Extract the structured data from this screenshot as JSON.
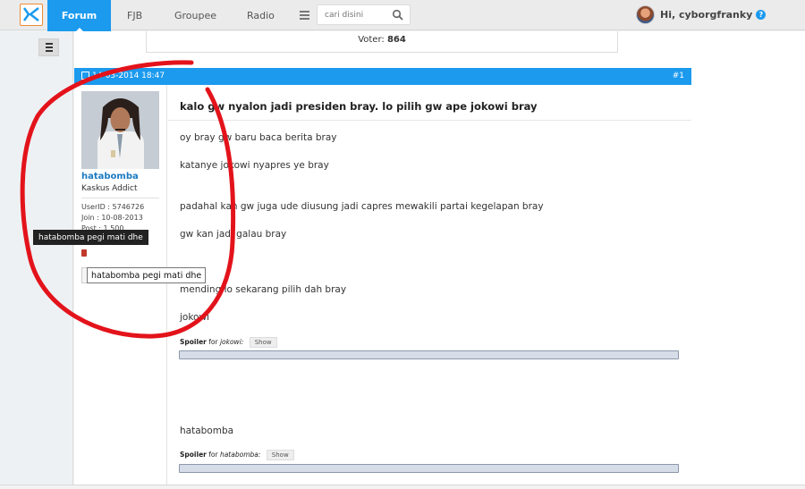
{
  "nav": {
    "items": [
      "Forum",
      "FJB",
      "Groupee",
      "Radio"
    ],
    "search_placeholder": "cari disini",
    "greeting": "Hi, cyborgfranky",
    "help_glyph": "?"
  },
  "poll": {
    "label": "Voter:",
    "value": "864"
  },
  "post": {
    "date": "14-03-2014 18:47",
    "number": "#1",
    "title": "kalo gw nyalon jadi presiden bray. lo pilih gw ape jokowi bray",
    "lines": [
      "oy bray gw baru baca berita bray",
      "katanye jokowi nyapres ye bray",
      "padahal kan gw juga ude diusung jadi capres mewakili partai kegelapan bray",
      "gw kan jadi galau bray",
      "mending lo sekarang pilih dah bray",
      "jokowi",
      "hatabomba"
    ],
    "spoilers": [
      {
        "label": "Spoiler",
        "for_text": "for",
        "target": "jokowi:",
        "button": "Show"
      },
      {
        "label": "Spoiler",
        "for_text": "for",
        "target": "hatabomba:",
        "button": "Show"
      }
    ]
  },
  "author": {
    "username": "hatabomba",
    "rank": "Kaskus Addict",
    "userid": "UserID : 5746726",
    "join": "Join     : 10-08-2013",
    "posts": "Post      : 1.500",
    "tooltip": "hatabomba pegi mati dhe"
  },
  "colors": {
    "brand_blue": "#1b9aee",
    "logo_orange": "#ef8b33",
    "annotation_red": "#e3131b"
  }
}
